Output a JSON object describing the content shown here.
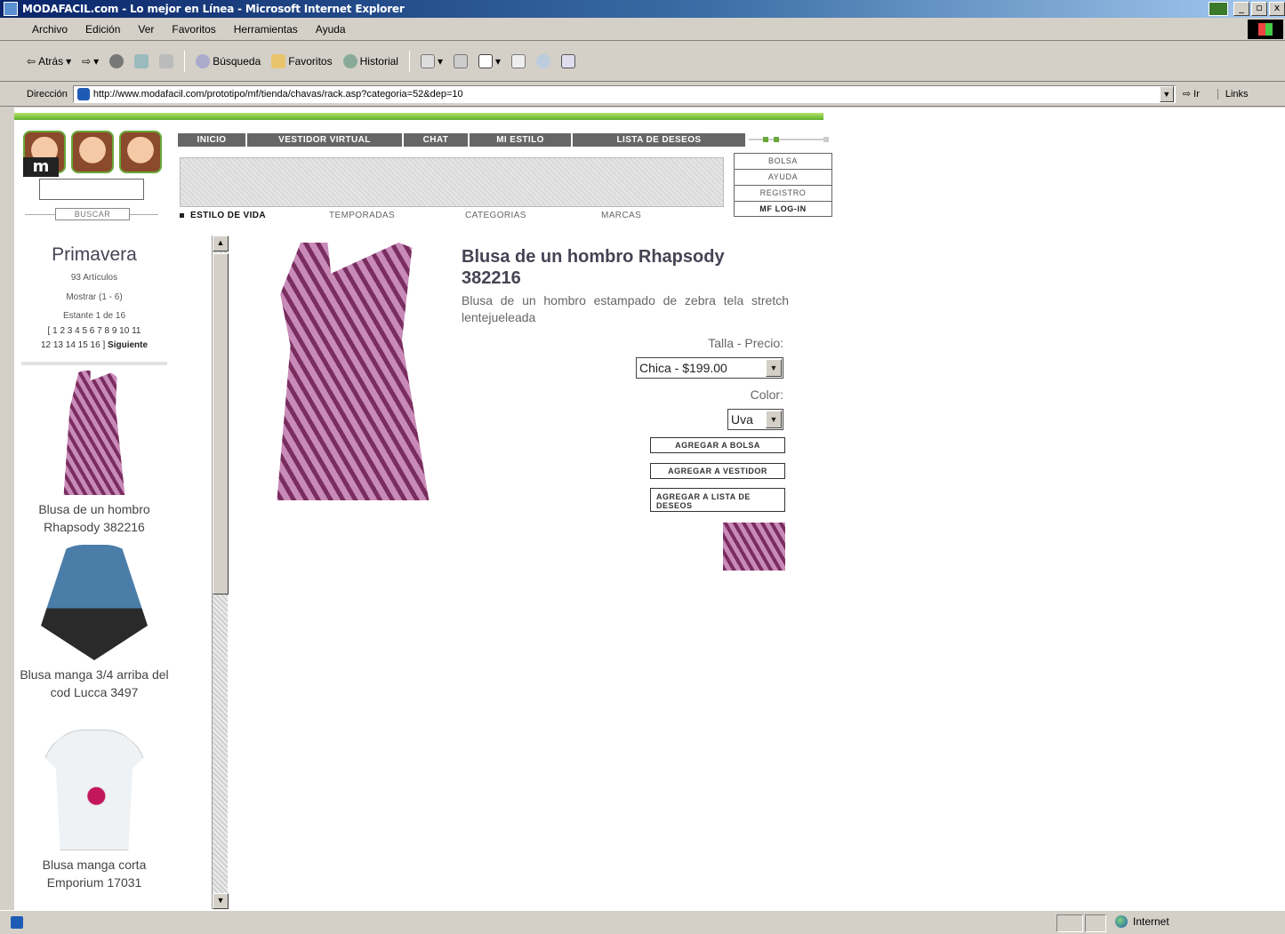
{
  "window": {
    "title": "MODAFACIL.com - Lo mejor en Línea - Microsoft Internet Explorer",
    "controls": {
      "minimize": "_",
      "maximize": "▫",
      "close": "x"
    }
  },
  "menu": [
    "Archivo",
    "Edición",
    "Ver",
    "Favoritos",
    "Herramientas",
    "Ayuda"
  ],
  "toolbar": {
    "back": "Atrás",
    "search": "Búsqueda",
    "favorites": "Favoritos",
    "history": "Historial"
  },
  "address": {
    "label": "Dirección",
    "url": "http://www.modafacil.com/prototipo/mf/tienda/chavas/rack.asp?categoria=52&dep=10",
    "go": "Ir",
    "links": "Links"
  },
  "site": {
    "nav": [
      "INICIO",
      "VESTIDOR VIRTUAL",
      "CHAT",
      "MI ESTILO",
      "LISTA DE DESEOS"
    ],
    "side_links": [
      "BOLSA",
      "AYUDA",
      "REGISTRO",
      "MF LOG-IN"
    ],
    "subnav": [
      "ESTILO DE VIDA",
      "TEMPORADAS",
      "CATEGORIAS",
      "MARCAS"
    ],
    "search_button": "BUSCAR",
    "search_value": ""
  },
  "list": {
    "season": "Primavera",
    "count": "93 Artículos",
    "showing": "Mostrar (1 - 6)",
    "shelf": "Estante 1 de 16",
    "pages_line1": "[ 1 2 3 4 5 6 7 8 9 10 11",
    "pages_line2": "12 13 14 15 16 ]",
    "next": "Siguiente",
    "items": [
      {
        "name": "Blusa de un hombro Rhapsody 382216",
        "icon": "zebra-blouse-thumb"
      },
      {
        "name": "Blusa manga 3/4 arriba del cod Lucca 3497",
        "icon": "lucca-blouse-thumb"
      },
      {
        "name": "Blusa manga corta Emporium 17031",
        "icon": "tshirt-thumb"
      }
    ]
  },
  "product": {
    "title": "Blusa de un hombro Rhapsody 382216",
    "description": "Blusa de un hombro estampado de zebra tela stretch lentejueleada",
    "size_label": "Talla - Precio:",
    "size_value": "Chica - $199.00",
    "color_label": "Color:",
    "color_value": "Uva",
    "btn_bag": "AGREGAR A BOLSA",
    "btn_dresser": "AGREGAR A VESTIDOR",
    "btn_wishlist": "AGREGAR A LISTA DE DESEOS"
  },
  "status": {
    "zone": "Internet"
  },
  "colors": {
    "accent_green": "#5db12a",
    "nav_gray": "#666666",
    "product_purple": "#b06aa0"
  }
}
